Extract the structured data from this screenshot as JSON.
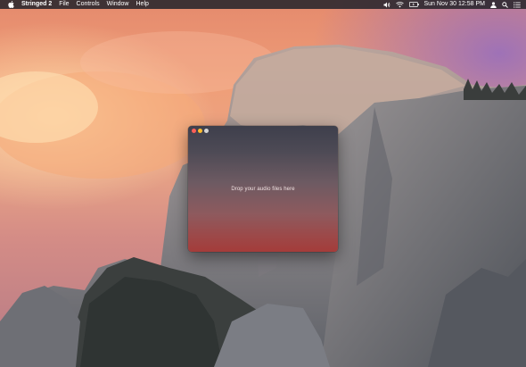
{
  "menubar": {
    "apple_icon": "apple-icon",
    "app_name": "Stringed 2",
    "menus": [
      "File",
      "Controls",
      "Window",
      "Help"
    ],
    "clock": "Sun Nov 30  12:58 PM",
    "status_icons": [
      "volume-icon",
      "wifi-icon",
      "battery-icon",
      "user-icon",
      "search-icon",
      "notification-list-icon"
    ]
  },
  "window": {
    "drop_prompt": "Drop your audio files here"
  },
  "colors": {
    "close": "#ff5f57",
    "minimize": "#febc2e",
    "zoom": "#d4d4d4"
  }
}
